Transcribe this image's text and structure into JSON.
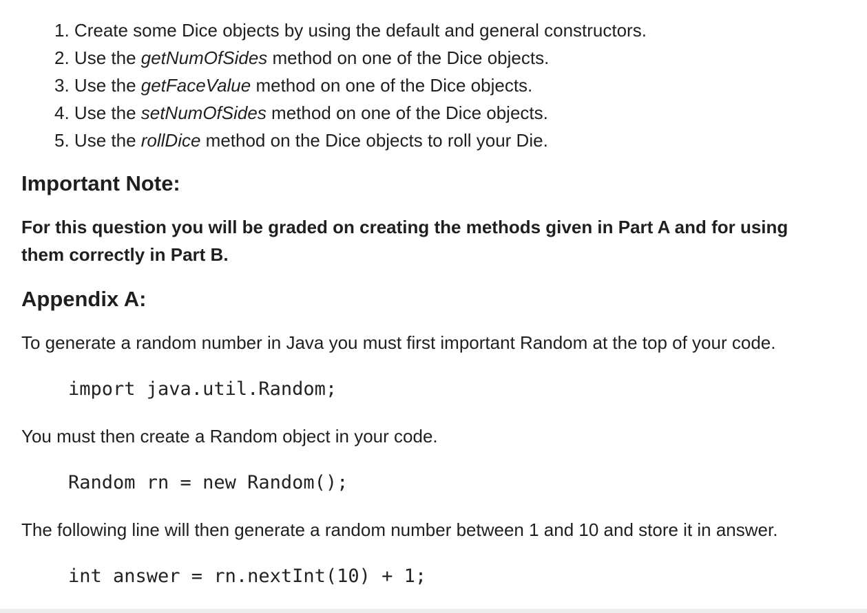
{
  "steps": [
    {
      "num": "1.",
      "before": "Create some Dice objects by using the default and general constructors.",
      "method": "",
      "after": ""
    },
    {
      "num": "2.",
      "before": "Use the ",
      "method": "getNumOfSides",
      "after": " method on one of the Dice objects."
    },
    {
      "num": "3.",
      "before": "Use the ",
      "method": "getFaceValue",
      "after": " method on one of the Dice objects."
    },
    {
      "num": "4.",
      "before": "Use the ",
      "method": "setNumOfSides",
      "after": " method on one of the Dice objects."
    },
    {
      "num": "5.",
      "before": "Use the ",
      "method": "rollDice",
      "after": " method on the Dice objects to roll your Die."
    }
  ],
  "important_note": {
    "heading": "Important Note:",
    "text": "For this question you will be graded on creating the methods given in Part A and for using them correctly in Part B."
  },
  "appendix": {
    "heading": "Appendix A:",
    "para1": "To generate a random number in Java you must first important Random at the top of your code.",
    "code1": "import java.util.Random;",
    "para2": "You must then create a Random object in your code.",
    "code2": "Random rn = new Random();",
    "para3": "The following line will then generate a random number between 1 and 10 and store it in answer.",
    "code3": "int answer = rn.nextInt(10) + 1;"
  }
}
